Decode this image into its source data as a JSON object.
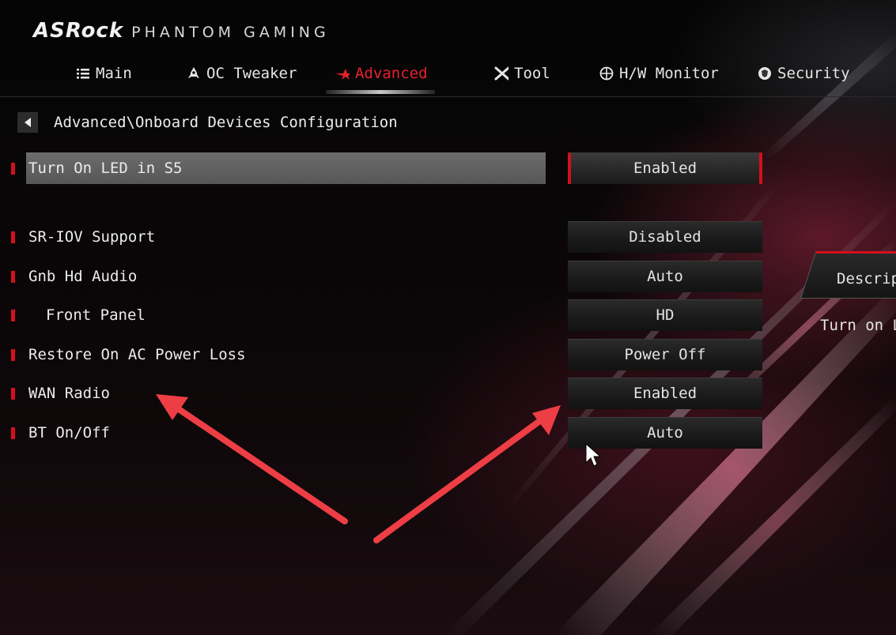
{
  "header": {
    "brand": "ASRock",
    "subtitle": "PHANTOM GAMING"
  },
  "tabs": [
    {
      "label": "Main",
      "icon": "list-icon"
    },
    {
      "label": "OC Tweaker",
      "icon": "rocket-icon"
    },
    {
      "label": "Advanced",
      "icon": "star-icon",
      "active": true
    },
    {
      "label": "Tool",
      "icon": "tools-icon"
    },
    {
      "label": "H/W Monitor",
      "icon": "crosshair-icon"
    },
    {
      "label": "Security",
      "icon": "shield-icon"
    }
  ],
  "breadcrumb": "Advanced\\Onboard Devices Configuration",
  "settings": [
    {
      "label": "Turn On LED in S5",
      "value": "Enabled",
      "selected": true
    },
    {
      "label": "SR-IOV Support",
      "value": "Disabled"
    },
    {
      "label": "Gnb Hd Audio",
      "value": "Auto"
    },
    {
      "label": "Front Panel",
      "value": "HD",
      "indented": true
    },
    {
      "label": "Restore On AC Power Loss",
      "value": "Power Off"
    },
    {
      "label": "WAN Radio",
      "value": "Enabled"
    },
    {
      "label": "BT On/Off",
      "value": "Auto"
    }
  ],
  "description": {
    "title": "Descrip",
    "text": "Turn on L"
  },
  "colors": {
    "accent": "#d4101c",
    "annotation_arrow": "#ee3e45"
  }
}
